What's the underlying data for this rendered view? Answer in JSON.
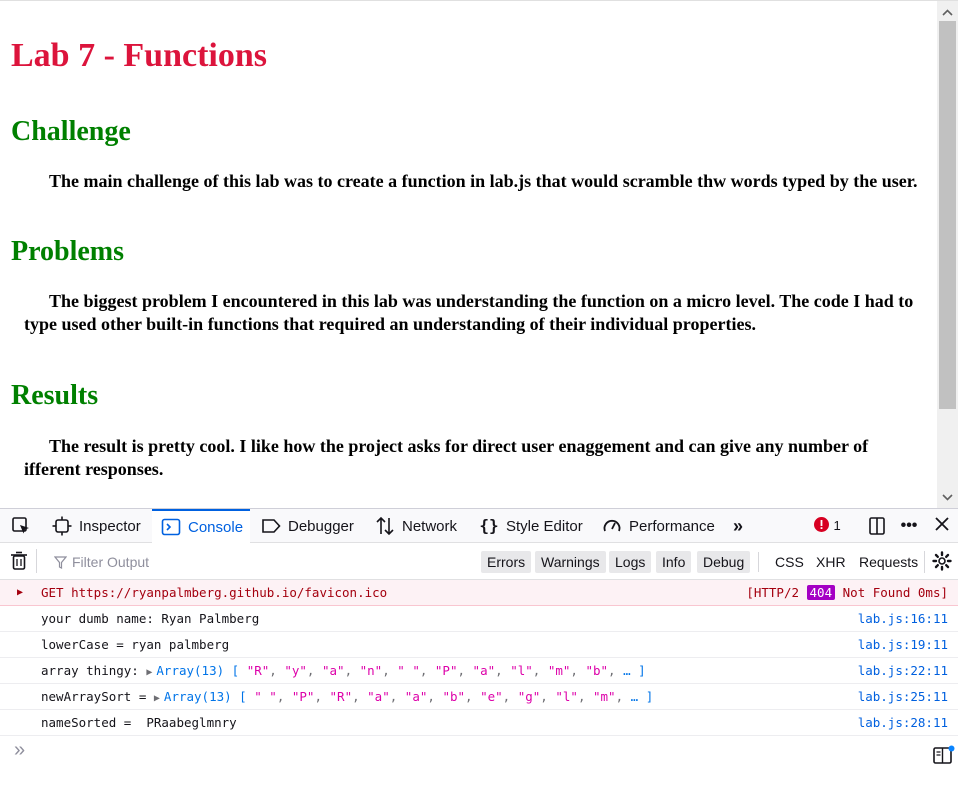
{
  "page": {
    "title": "Lab 7 - Functions",
    "sections": [
      {
        "heading": "Challenge",
        "text": "The main challenge of this lab was to create a function in lab.js that would scramble thw words typed by the user."
      },
      {
        "heading": "Problems",
        "text": "The biggest problem I encountered in this lab was understanding the function on a micro level. The code I had to type used other built-in functions that required an understanding of their individual properties."
      },
      {
        "heading": "Results",
        "text": "The result is pretty cool. I like how the project asks for direct user enaggement and can give any number of ifferent responses."
      }
    ]
  },
  "devtools": {
    "tabs": [
      "Inspector",
      "Console",
      "Debugger",
      "Network",
      "Style Editor",
      "Performance"
    ],
    "active_tab": "Console",
    "error_count": "1",
    "filter": {
      "placeholder": "Filter Output",
      "levels": [
        "Errors",
        "Warnings",
        "Logs",
        "Info",
        "Debug"
      ],
      "types": [
        "CSS",
        "XHR",
        "Requests"
      ]
    },
    "messages": [
      {
        "kind": "error",
        "method": "GET",
        "url": "https://ryanpalmberg.github.io/favicon.ico",
        "status_prefix": "[HTTP/2",
        "status_code": "404",
        "status_suffix": "Not Found 0ms]"
      },
      {
        "kind": "log",
        "text": "your dumb name: Ryan Palmberg",
        "loc": "lab.js:16:11"
      },
      {
        "kind": "log",
        "text": "lowerCase = ryan palmberg",
        "loc": "lab.js:19:11"
      },
      {
        "kind": "array",
        "label": "array thingy: ",
        "array_name": "Array(13)",
        "items": [
          "\"R\"",
          "\"y\"",
          "\"a\"",
          "\"n\"",
          "\" \"",
          "\"P\"",
          "\"a\"",
          "\"l\"",
          "\"m\"",
          "\"b\""
        ],
        "more": "… ]",
        "loc": "lab.js:22:11"
      },
      {
        "kind": "array",
        "label": "newArraySort = ",
        "array_name": "Array(13)",
        "items": [
          "\" \"",
          "\"P\"",
          "\"R\"",
          "\"a\"",
          "\"a\"",
          "\"b\"",
          "\"e\"",
          "\"g\"",
          "\"l\"",
          "\"m\""
        ],
        "more": "… ]",
        "loc": "lab.js:25:11"
      },
      {
        "kind": "log",
        "text": "nameSorted =  PRaabeglmnry",
        "loc": "lab.js:28:11"
      }
    ],
    "prompt": "»"
  },
  "colors": {
    "title": "#dc143c",
    "heading": "#008000",
    "accent": "#0061e0",
    "error_bg": "#fdf2f5",
    "badge": "#a400c4"
  }
}
